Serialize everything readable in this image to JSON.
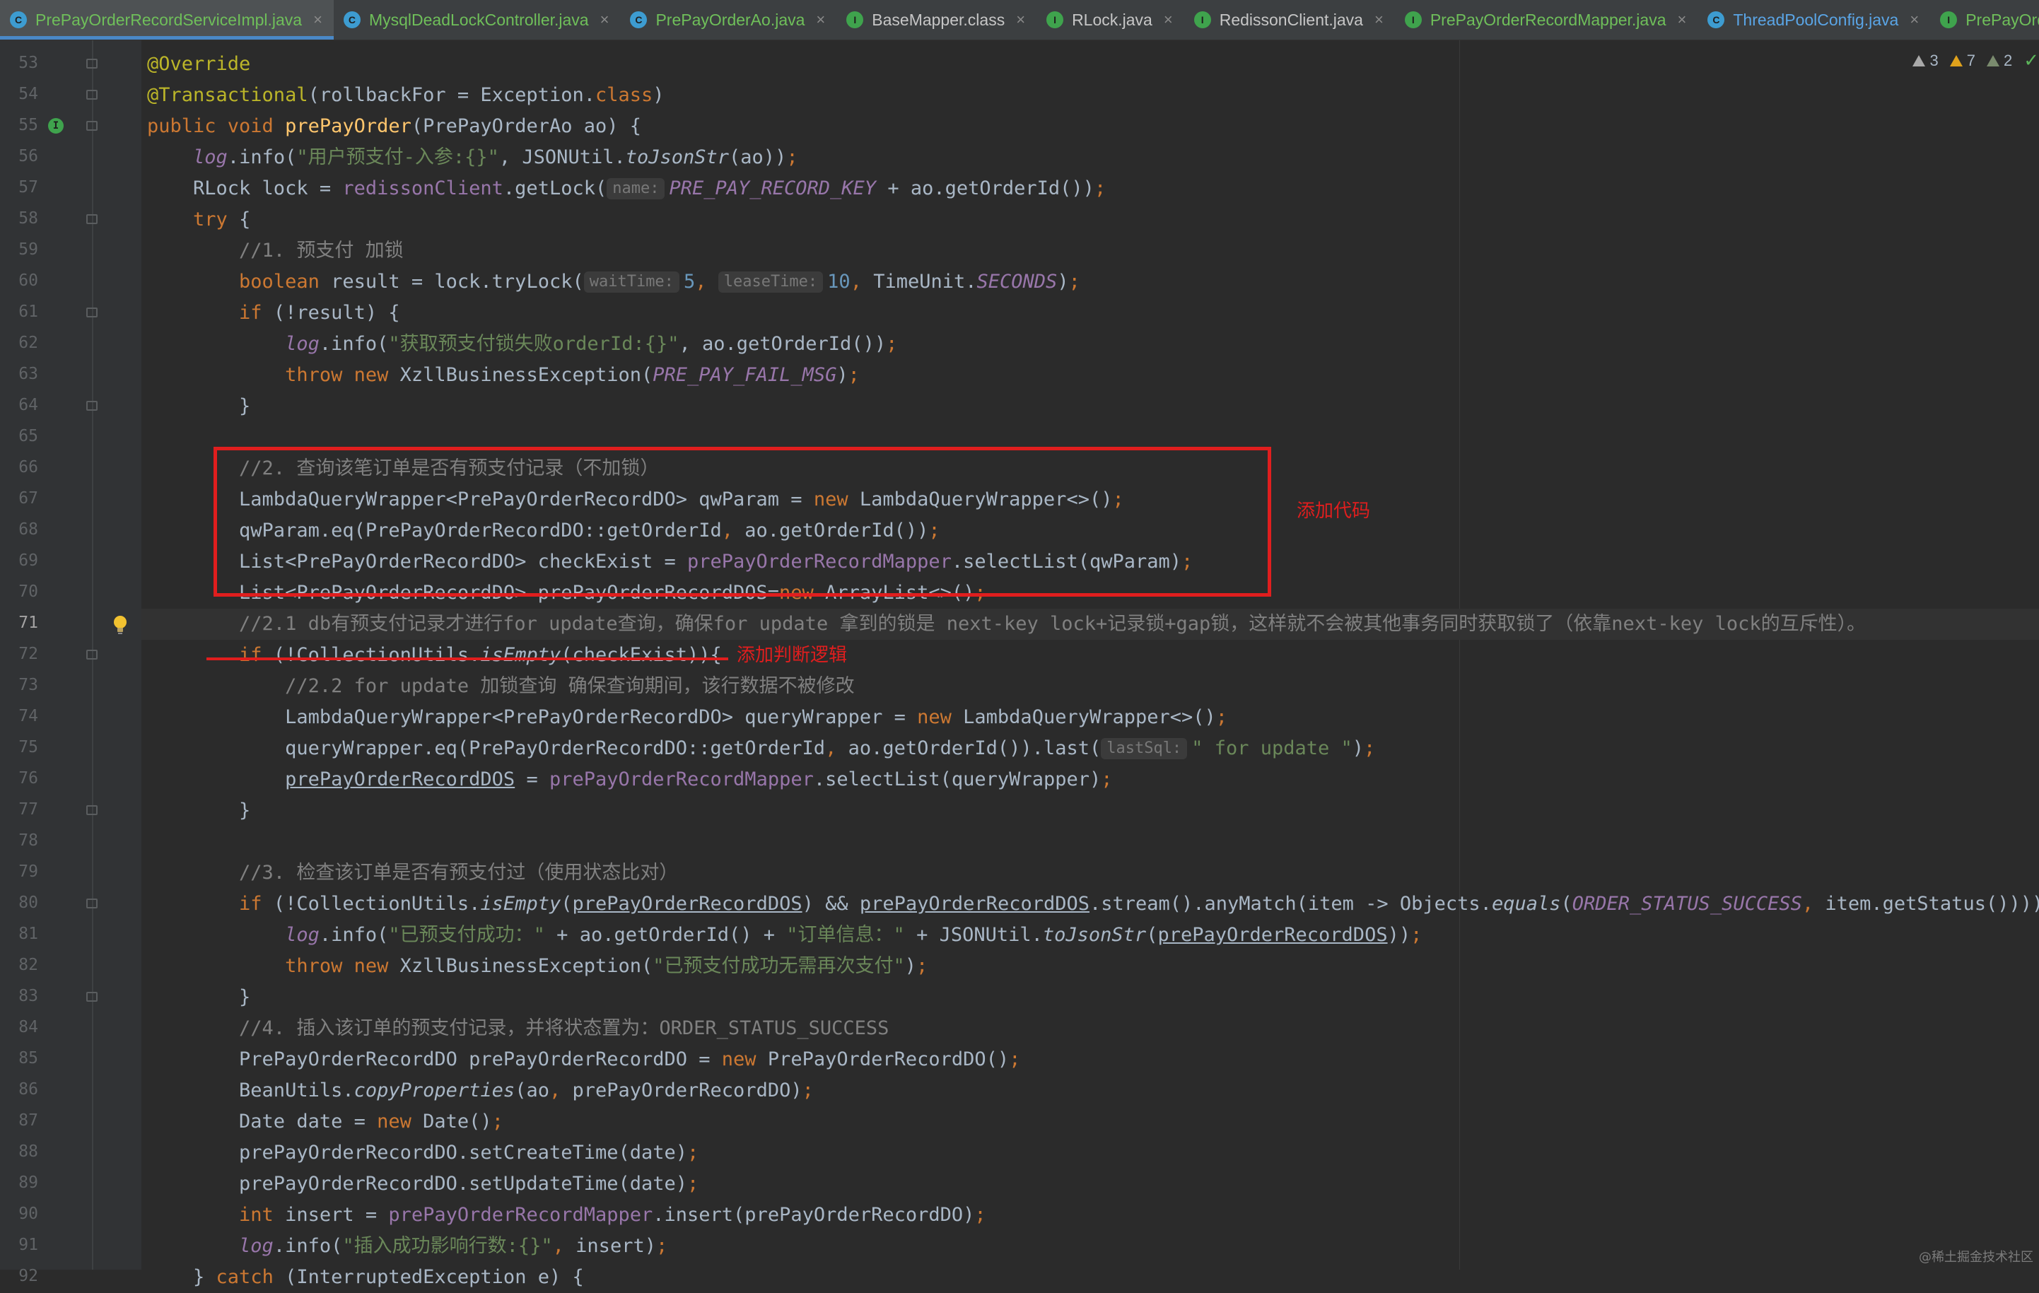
{
  "tabs": [
    {
      "label": "PrePayOrderRecordServiceImpl.java",
      "icon": "class",
      "color": "green",
      "active": true
    },
    {
      "label": "MysqlDeadLockController.java",
      "icon": "class",
      "color": "green",
      "active": false
    },
    {
      "label": "PrePayOrderAo.java",
      "icon": "class",
      "color": "green",
      "active": false
    },
    {
      "label": "BaseMapper.class",
      "icon": "interface",
      "color": "gray",
      "active": false
    },
    {
      "label": "RLock.java",
      "icon": "interface",
      "color": "gray",
      "active": false
    },
    {
      "label": "RedissonClient.java",
      "icon": "interface",
      "color": "gray",
      "active": false
    },
    {
      "label": "PrePayOrderRecordMapper.java",
      "icon": "interface",
      "color": "green",
      "active": false
    },
    {
      "label": "ThreadPoolConfig.java",
      "icon": "class",
      "color": "blue",
      "active": false
    },
    {
      "label": "PrePayOrd",
      "icon": "interface",
      "color": "green",
      "active": false
    }
  ],
  "inspections": {
    "weak_warnings": "3",
    "warnings": "7",
    "typos": "2"
  },
  "current_line": 71,
  "annotations": {
    "box_label": "添加代码",
    "underline_label": "添加判断逻辑"
  },
  "code_lines": [
    {
      "n": 53,
      "tokens": [
        [
          "ann",
          "@Override"
        ]
      ]
    },
    {
      "n": 54,
      "tokens": [
        [
          "ann",
          "@Transactional"
        ],
        [
          "p",
          "(rollbackFor = Exception."
        ],
        [
          "kw",
          "class"
        ],
        [
          "p",
          ")"
        ]
      ]
    },
    {
      "n": 55,
      "tokens": [
        [
          "kw",
          "public void "
        ],
        [
          "fn",
          "prePayOrder"
        ],
        [
          "p",
          "(PrePayOrderAo ao) {"
        ]
      ]
    },
    {
      "n": 56,
      "tokens": [
        [
          "p",
          "    "
        ],
        [
          "log",
          "log"
        ],
        [
          "p",
          ".info("
        ],
        [
          "str",
          "\"用户预支付-入参:{}\""
        ],
        [
          "p",
          ", JSONUtil."
        ],
        [
          "st",
          "toJsonStr"
        ],
        [
          "p",
          "(ao))"
        ],
        [
          "kw",
          ";"
        ]
      ]
    },
    {
      "n": 57,
      "tokens": [
        [
          "p",
          "    RLock lock = "
        ],
        [
          "fld",
          "redissonClient"
        ],
        [
          "p",
          ".getLock("
        ],
        [
          "hint",
          "name:"
        ],
        [
          "const",
          "PRE_PAY_RECORD_KEY"
        ],
        [
          "p",
          " + ao.getOrderId())"
        ],
        [
          "kw",
          ";"
        ]
      ]
    },
    {
      "n": 58,
      "tokens": [
        [
          "p",
          "    "
        ],
        [
          "kw",
          "try"
        ],
        [
          "p",
          " {"
        ]
      ]
    },
    {
      "n": 59,
      "tokens": [
        [
          "p",
          "        "
        ],
        [
          "cmt",
          "//1. 预支付 加锁"
        ]
      ]
    },
    {
      "n": 60,
      "tokens": [
        [
          "p",
          "        "
        ],
        [
          "kw",
          "boolean"
        ],
        [
          "p",
          " result = lock.tryLock("
        ],
        [
          "hint",
          "waitTime:"
        ],
        [
          "num",
          "5"
        ],
        [
          "kw",
          ", "
        ],
        [
          "hint",
          "leaseTime:"
        ],
        [
          "num",
          "10"
        ],
        [
          "kw",
          ", "
        ],
        [
          "p",
          "TimeUnit."
        ],
        [
          "const",
          "SECONDS"
        ],
        [
          "p",
          ")"
        ],
        [
          "kw",
          ";"
        ]
      ]
    },
    {
      "n": 61,
      "tokens": [
        [
          "p",
          "        "
        ],
        [
          "kw",
          "if"
        ],
        [
          "p",
          " (!result) {"
        ]
      ]
    },
    {
      "n": 62,
      "tokens": [
        [
          "p",
          "            "
        ],
        [
          "log",
          "log"
        ],
        [
          "p",
          ".info("
        ],
        [
          "str",
          "\"获取预支付锁失败orderId:{}\""
        ],
        [
          "p",
          ", ao.getOrderId())"
        ],
        [
          "kw",
          ";"
        ]
      ]
    },
    {
      "n": 63,
      "tokens": [
        [
          "p",
          "            "
        ],
        [
          "kw",
          "throw new "
        ],
        [
          "p",
          "XzllBusinessException("
        ],
        [
          "const",
          "PRE_PAY_FAIL_MSG"
        ],
        [
          "p",
          ")"
        ],
        [
          "kw",
          ";"
        ]
      ]
    },
    {
      "n": 64,
      "tokens": [
        [
          "p",
          "        }"
        ]
      ]
    },
    {
      "n": 65,
      "tokens": []
    },
    {
      "n": 66,
      "tokens": [
        [
          "p",
          "        "
        ],
        [
          "cmt",
          "//2. 查询该笔订单是否有预支付记录（不加锁）"
        ]
      ]
    },
    {
      "n": 67,
      "tokens": [
        [
          "p",
          "        LambdaQueryWrapper<PrePayOrderRecordDO> qwParam = "
        ],
        [
          "kw",
          "new "
        ],
        [
          "p",
          "LambdaQueryWrapper<>()"
        ],
        [
          "kw",
          ";"
        ]
      ]
    },
    {
      "n": 68,
      "tokens": [
        [
          "p",
          "        qwParam.eq(PrePayOrderRecordDO::getOrderId"
        ],
        [
          "kw",
          ", "
        ],
        [
          "p",
          "ao.getOrderId())"
        ],
        [
          "kw",
          ";"
        ]
      ]
    },
    {
      "n": 69,
      "tokens": [
        [
          "p",
          "        List<PrePayOrderRecordDO> checkExist = "
        ],
        [
          "fld",
          "prePayOrderRecordMapper"
        ],
        [
          "p",
          ".selectList(qwParam)"
        ],
        [
          "kw",
          ";"
        ]
      ]
    },
    {
      "n": 70,
      "tokens": [
        [
          "p",
          "        List<PrePayOrderRecordDO> prePayOrderRecordDOS="
        ],
        [
          "kw",
          "new "
        ],
        [
          "p",
          "ArrayList<>()"
        ],
        [
          "kw",
          ";"
        ]
      ]
    },
    {
      "n": 71,
      "tokens": [
        [
          "p",
          "        "
        ],
        [
          "cmt",
          "//2.1 db有预支付记录才进行for update查询，确保for update 拿到的锁是 next-key lock+记录锁+gap锁，这样就不会被其他事务同时获取锁了（依靠next-key lock的互斥性）。"
        ]
      ]
    },
    {
      "n": 72,
      "tokens": [
        [
          "p",
          "        "
        ],
        [
          "kw",
          "if"
        ],
        [
          "p",
          " (!CollectionUtils."
        ],
        [
          "st",
          "isEmpty"
        ],
        [
          "p",
          "(checkExist)){"
        ]
      ]
    },
    {
      "n": 73,
      "tokens": [
        [
          "p",
          "            "
        ],
        [
          "cmt",
          "//2.2 for update 加锁查询 确保查询期间，该行数据不被修改"
        ]
      ]
    },
    {
      "n": 74,
      "tokens": [
        [
          "p",
          "            LambdaQueryWrapper<PrePayOrderRecordDO> queryWrapper = "
        ],
        [
          "kw",
          "new "
        ],
        [
          "p",
          "LambdaQueryWrapper<>()"
        ],
        [
          "kw",
          ";"
        ]
      ]
    },
    {
      "n": 75,
      "tokens": [
        [
          "p",
          "            queryWrapper.eq(PrePayOrderRecordDO::getOrderId"
        ],
        [
          "kw",
          ", "
        ],
        [
          "p",
          "ao.getOrderId()).last("
        ],
        [
          "hint",
          "lastSql:"
        ],
        [
          "str",
          "\" for update \""
        ],
        [
          "p",
          ")"
        ],
        [
          "kw",
          ";"
        ]
      ]
    },
    {
      "n": 76,
      "tokens": [
        [
          "p",
          "            "
        ],
        [
          "und",
          "prePayOrderRecordDOS"
        ],
        [
          "p",
          " = "
        ],
        [
          "fld",
          "prePayOrderRecordMapper"
        ],
        [
          "p",
          ".selectList(queryWrapper)"
        ],
        [
          "kw",
          ";"
        ]
      ]
    },
    {
      "n": 77,
      "tokens": [
        [
          "p",
          "        }"
        ]
      ]
    },
    {
      "n": 78,
      "tokens": []
    },
    {
      "n": 79,
      "tokens": [
        [
          "p",
          "        "
        ],
        [
          "cmt",
          "//3. 检查该订单是否有预支付过（使用状态比对）"
        ]
      ]
    },
    {
      "n": 80,
      "tokens": [
        [
          "p",
          "        "
        ],
        [
          "kw",
          "if"
        ],
        [
          "p",
          " (!CollectionUtils."
        ],
        [
          "st",
          "isEmpty"
        ],
        [
          "p",
          "("
        ],
        [
          "und",
          "prePayOrderRecordDOS"
        ],
        [
          "p",
          ") && "
        ],
        [
          "und",
          "prePayOrderRecordDOS"
        ],
        [
          "p",
          ".stream().anyMatch(item -> Objects."
        ],
        [
          "st",
          "equals"
        ],
        [
          "p",
          "("
        ],
        [
          "const",
          "ORDER_STATUS_SUCCESS"
        ],
        [
          "kw",
          ", "
        ],
        [
          "p",
          "item.getStatus()))) {"
        ]
      ]
    },
    {
      "n": 81,
      "tokens": [
        [
          "p",
          "            "
        ],
        [
          "log",
          "log"
        ],
        [
          "p",
          ".info("
        ],
        [
          "str",
          "\"已预支付成功：\""
        ],
        [
          "p",
          " + ao.getOrderId() + "
        ],
        [
          "str",
          "\"订单信息：\""
        ],
        [
          "p",
          " + JSONUtil."
        ],
        [
          "st",
          "toJsonStr"
        ],
        [
          "p",
          "("
        ],
        [
          "und",
          "prePayOrderRecordDOS"
        ],
        [
          "p",
          "))"
        ],
        [
          "kw",
          ";"
        ]
      ]
    },
    {
      "n": 82,
      "tokens": [
        [
          "p",
          "            "
        ],
        [
          "kw",
          "throw new "
        ],
        [
          "p",
          "XzllBusinessException("
        ],
        [
          "str",
          "\"已预支付成功无需再次支付\""
        ],
        [
          "p",
          ")"
        ],
        [
          "kw",
          ";"
        ]
      ]
    },
    {
      "n": 83,
      "tokens": [
        [
          "p",
          "        }"
        ]
      ]
    },
    {
      "n": 84,
      "tokens": [
        [
          "p",
          "        "
        ],
        [
          "cmt",
          "//4. 插入该订单的预支付记录，并将状态置为：ORDER_STATUS_SUCCESS"
        ]
      ]
    },
    {
      "n": 85,
      "tokens": [
        [
          "p",
          "        PrePayOrderRecordDO prePayOrderRecordDO = "
        ],
        [
          "kw",
          "new "
        ],
        [
          "p",
          "PrePayOrderRecordDO()"
        ],
        [
          "kw",
          ";"
        ]
      ]
    },
    {
      "n": 86,
      "tokens": [
        [
          "p",
          "        BeanUtils."
        ],
        [
          "st",
          "copyProperties"
        ],
        [
          "p",
          "(ao"
        ],
        [
          "kw",
          ", "
        ],
        [
          "p",
          "prePayOrderRecordDO)"
        ],
        [
          "kw",
          ";"
        ]
      ]
    },
    {
      "n": 87,
      "tokens": [
        [
          "p",
          "        Date date = "
        ],
        [
          "kw",
          "new "
        ],
        [
          "p",
          "Date()"
        ],
        [
          "kw",
          ";"
        ]
      ]
    },
    {
      "n": 88,
      "tokens": [
        [
          "p",
          "        prePayOrderRecordDO.setCreateTime(date)"
        ],
        [
          "kw",
          ";"
        ]
      ]
    },
    {
      "n": 89,
      "tokens": [
        [
          "p",
          "        prePayOrderRecordDO.setUpdateTime(date)"
        ],
        [
          "kw",
          ";"
        ]
      ]
    },
    {
      "n": 90,
      "tokens": [
        [
          "p",
          "        "
        ],
        [
          "kw",
          "int"
        ],
        [
          "p",
          " insert = "
        ],
        [
          "fld",
          "prePayOrderRecordMapper"
        ],
        [
          "p",
          ".insert(prePayOrderRecordDO)"
        ],
        [
          "kw",
          ";"
        ]
      ]
    },
    {
      "n": 91,
      "tokens": [
        [
          "p",
          "        "
        ],
        [
          "log",
          "log"
        ],
        [
          "p",
          ".info("
        ],
        [
          "str",
          "\"插入成功影响行数:{}\""
        ],
        [
          "kw",
          ", "
        ],
        [
          "p",
          "insert)"
        ],
        [
          "kw",
          ";"
        ]
      ]
    },
    {
      "n": 92,
      "tokens": [
        [
          "p",
          "    } "
        ],
        [
          "kw",
          "catch"
        ],
        [
          "p",
          " (InterruptedException e) {"
        ]
      ]
    }
  ],
  "watermark": "@稀土掘金技术社区"
}
